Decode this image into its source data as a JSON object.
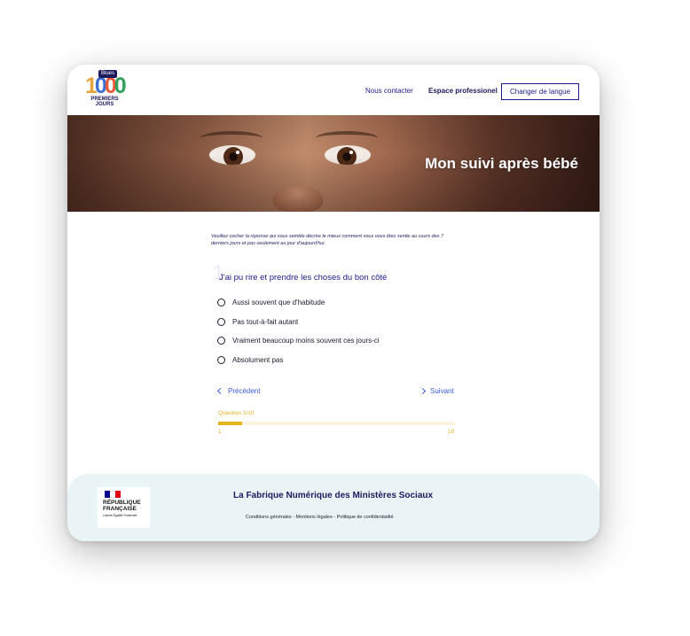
{
  "header": {
    "logo": {
      "digits": [
        "1",
        "0",
        "0",
        "0"
      ],
      "tag": "Blues",
      "line1": "PREMIERS",
      "line2": "JOURS"
    },
    "nav_contact": "Nous contacter",
    "nav_pro": "Espace professionel",
    "lang_button": "Changer de langue"
  },
  "hero": {
    "title": "Mon suivi après bébé"
  },
  "form": {
    "intro": "Veuillez cocher la réponse qui vous semble décrire le mieux comment vous vous êtes sentie au cours des 7 derniers jours et pas seulement au jour d'aujourd'hui.",
    "question_number": "1",
    "question_title": "J'ai pu rire et prendre les choses du bon côté",
    "options": [
      "Aussi souvent que d'habitude",
      "Pas tout-à-fait autant",
      "Vraiment beaucoup moins souvent ces jours-ci",
      "Absolument pas"
    ],
    "prev_label": "Précédent",
    "next_label": "Suivant"
  },
  "progress": {
    "label": "Question 1/10",
    "current": 1,
    "total": 10,
    "min_label": "1",
    "max_label": "10"
  },
  "footer": {
    "republic_line1": "RÉPUBLIQUE",
    "republic_line2": "FRANÇAISE",
    "motto": "Liberté Égalité Fraternité",
    "title": "La Fabrique Numérique des Ministères Sociaux",
    "links": "Conditions générales - Mentions légales - Politique de confidentialité"
  },
  "colors": {
    "navy": "#1b1b5e",
    "accent_blue": "#3a5bd9",
    "progress_yellow": "#e7b31d",
    "footer_bg": "#eaf4f6",
    "flag_blue": "#000091",
    "flag_red": "#e1000f"
  }
}
